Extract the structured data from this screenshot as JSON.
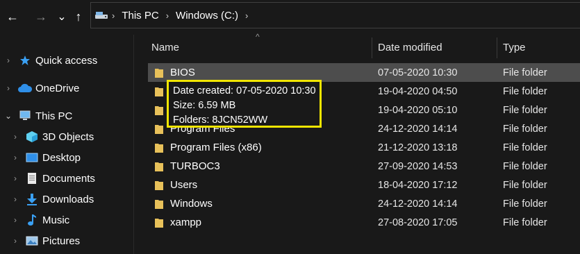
{
  "nav": {
    "back_icon": "←",
    "forward_icon": "→",
    "recent_icon": "⌄",
    "up_icon": "↑"
  },
  "address": {
    "breadcrumbs": [
      "This PC",
      "Windows (C:)"
    ],
    "separator": "›"
  },
  "sidebar": {
    "items": [
      {
        "label": "Quick access",
        "icon": "star-icon",
        "expand": "›"
      },
      {
        "label": "OneDrive",
        "icon": "cloud-icon",
        "expand": "›"
      },
      {
        "label": "This PC",
        "icon": "computer-icon",
        "expand": "⌄"
      },
      {
        "label": "3D Objects",
        "icon": "cube-icon",
        "expand": "›"
      },
      {
        "label": "Desktop",
        "icon": "desktop-icon",
        "expand": "›"
      },
      {
        "label": "Documents",
        "icon": "document-icon",
        "expand": "›"
      },
      {
        "label": "Downloads",
        "icon": "download-icon",
        "expand": "›"
      },
      {
        "label": "Music",
        "icon": "music-icon",
        "expand": "›"
      },
      {
        "label": "Pictures",
        "icon": "picture-icon",
        "expand": "›"
      }
    ]
  },
  "columns": {
    "name": "Name",
    "date_modified": "Date modified",
    "type": "Type",
    "sort_indicator": "^"
  },
  "files": [
    {
      "name": "BIOS",
      "date": "07-05-2020 10:30",
      "type": "File folder",
      "selected": true
    },
    {
      "name": "",
      "date": "19-04-2020 04:50",
      "type": "File folder"
    },
    {
      "name": "",
      "date": "19-04-2020 05:10",
      "type": "File folder"
    },
    {
      "name": "Program Files",
      "date": "24-12-2020 14:14",
      "type": "File folder"
    },
    {
      "name": "Program Files (x86)",
      "date": "21-12-2020 13:18",
      "type": "File folder"
    },
    {
      "name": "TURBOC3",
      "date": "27-09-2020 14:53",
      "type": "File folder"
    },
    {
      "name": "Users",
      "date": "18-04-2020 17:12",
      "type": "File folder"
    },
    {
      "name": "Windows",
      "date": "24-12-2020 14:14",
      "type": "File folder"
    },
    {
      "name": "xampp",
      "date": "27-08-2020 17:05",
      "type": "File folder"
    }
  ],
  "tooltip": {
    "date_created": "Date created: 07-05-2020 10:30",
    "size": "Size: 6.59 MB",
    "folders": "Folders: 8JCN52WW"
  },
  "colors": {
    "background": "#191919",
    "selected_row": "#4d4d4d",
    "highlight_border": "#f2e600",
    "folder": "#e8c15a"
  }
}
